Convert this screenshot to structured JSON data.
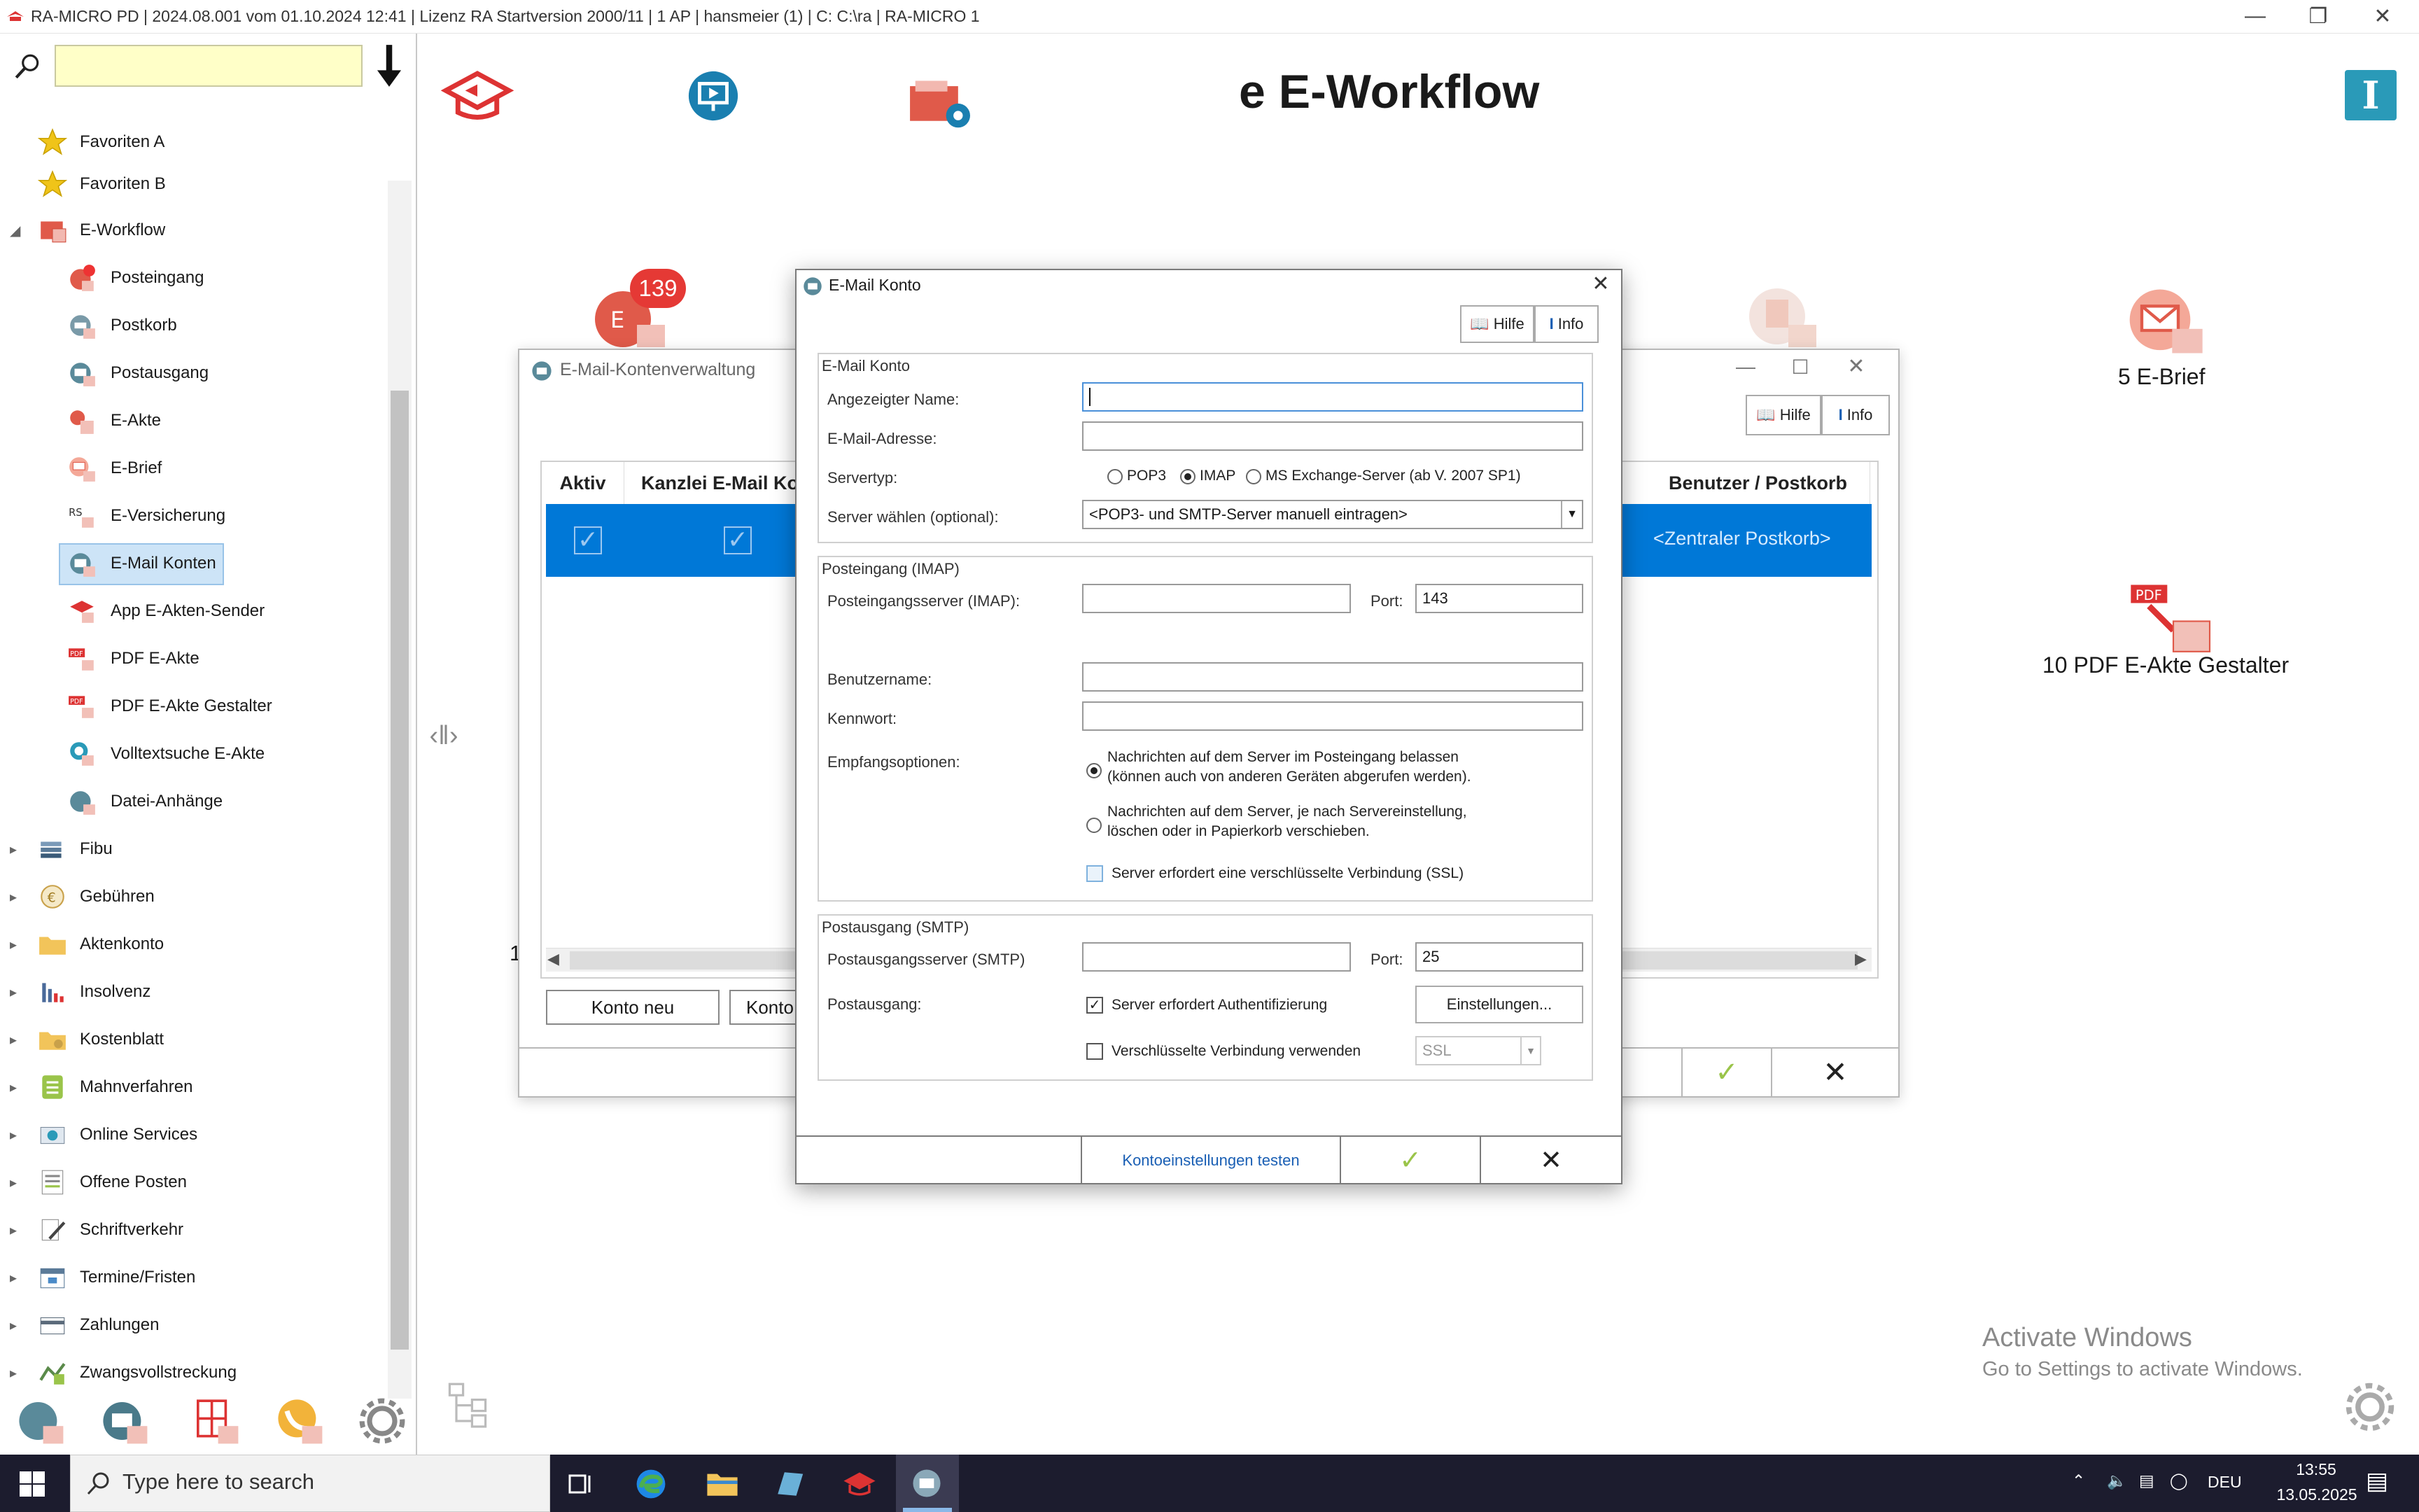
{
  "window": {
    "title": "RA-MICRO PD | 2024.08.001 vom 01.10.2024 12:41 | Lizenz RA Startversion  2000/11 | 1 AP | hansmeier (1) | C: C:\\ra | RA-MICRO 1"
  },
  "sidebar": {
    "search_placeholder": "",
    "favorites": [
      {
        "label": "Favoriten A"
      },
      {
        "label": "Favoriten B"
      }
    ],
    "group": {
      "label": "E-Workflow"
    },
    "items": [
      {
        "label": "Posteingang",
        "badge": "139"
      },
      {
        "label": "Postkorb"
      },
      {
        "label": "Postausgang"
      },
      {
        "label": "E-Akte"
      },
      {
        "label": "E-Brief"
      },
      {
        "label": "E-Versicherung"
      },
      {
        "label": "E-Mail Konten"
      },
      {
        "label": "App E-Akten-Sender"
      },
      {
        "label": "PDF E-Akte"
      },
      {
        "label": "PDF E-Akte Gestalter"
      },
      {
        "label": "Volltextsuche E-Akte"
      },
      {
        "label": "Datei-Anhänge"
      }
    ],
    "sections": [
      {
        "label": "Fibu"
      },
      {
        "label": "Gebühren"
      },
      {
        "label": "Aktenkonto"
      },
      {
        "label": "Insolvenz"
      },
      {
        "label": "Kostenblatt"
      },
      {
        "label": "Mahnverfahren"
      },
      {
        "label": "Online Services"
      },
      {
        "label": "Offene Posten"
      },
      {
        "label": "Schriftverkehr"
      },
      {
        "label": "Termine/Fristen"
      },
      {
        "label": "Zahlungen"
      },
      {
        "label": "Zwangsvollstreckung"
      }
    ]
  },
  "main": {
    "title": "e  E-Workflow",
    "badge_count": "139",
    "tiles": [
      {
        "label": "5   E-Brief"
      },
      {
        "label": "10   PDF E-Akte Gestalter"
      }
    ],
    "partial_number": "1"
  },
  "kontenverwaltung": {
    "title": "E-Mail-Kontenverwaltung",
    "help_label": "Hilfe",
    "info_label": "Info",
    "columns": [
      "Aktiv",
      "Kanzlei E-Mail Ko",
      "Benutzer / Postkorb"
    ],
    "row": {
      "benutzer": "<Zentraler Postkorb>"
    },
    "btn_new": "Konto neu",
    "btn_second": "Konto"
  },
  "dialog": {
    "title": "E-Mail Konto",
    "help_label": "Hilfe",
    "info_label": "Info",
    "account": {
      "group_title": "E-Mail Konto",
      "name_label": "Angezeigter Name:",
      "name_value": "",
      "email_label": "E-Mail-Adresse:",
      "email_value": "",
      "servertype_label": "Servertyp:",
      "servertypes": [
        "POP3",
        "IMAP",
        "MS Exchange-Server (ab V. 2007 SP1)"
      ],
      "servertype_selected": "IMAP",
      "server_select_label": "Server wählen (optional):",
      "server_select_value": "<POP3- und SMTP-Server manuell eintragen>"
    },
    "incoming": {
      "group_title": "Posteingang (IMAP)",
      "server_label": "Posteingangsserver (IMAP):",
      "server_value": "",
      "port_label": "Port:",
      "port_value": "143",
      "user_label": "Benutzername:",
      "user_value": "",
      "password_label": "Kennwort:",
      "password_value": "",
      "options_label": "Empfangsoptionen:",
      "option1_line1": "Nachrichten auf dem Server im Posteingang belassen",
      "option1_line2": "(können auch von anderen Geräten abgerufen werden).",
      "option2_line1": "Nachrichten auf dem Server, je nach Servereinstellung,",
      "option2_line2": "löschen oder in Papierkorb verschieben.",
      "ssl_label": "Server erfordert eine verschlüsselte Verbindung (SSL)"
    },
    "outgoing": {
      "group_title": "Postausgang (SMTP)",
      "server_label": "Postausgangsserver (SMTP)",
      "server_value": "",
      "port_label": "Port:",
      "port_value": "25",
      "auth_section_label": "Postausgang:",
      "auth_label": "Server erfordert Authentifizierung",
      "settings_button": "Einstellungen...",
      "encrypt_label": "Verschlüsselte Verbindung verwenden",
      "encrypt_value": "SSL"
    },
    "test_button": "Kontoeinstellungen testen"
  },
  "watermark": {
    "line1": "Activate Windows",
    "line2": "Go to Settings to activate Windows."
  },
  "taskbar": {
    "search_placeholder": "Type here to search",
    "language": "DEU",
    "time": "13:55",
    "date": "13.05.2025"
  },
  "colors": {
    "selection_blue": "#0078d7",
    "accent_red": "#e04a3a",
    "search_yellow": "#ffffc8",
    "link_blue": "#1a5fb4"
  }
}
